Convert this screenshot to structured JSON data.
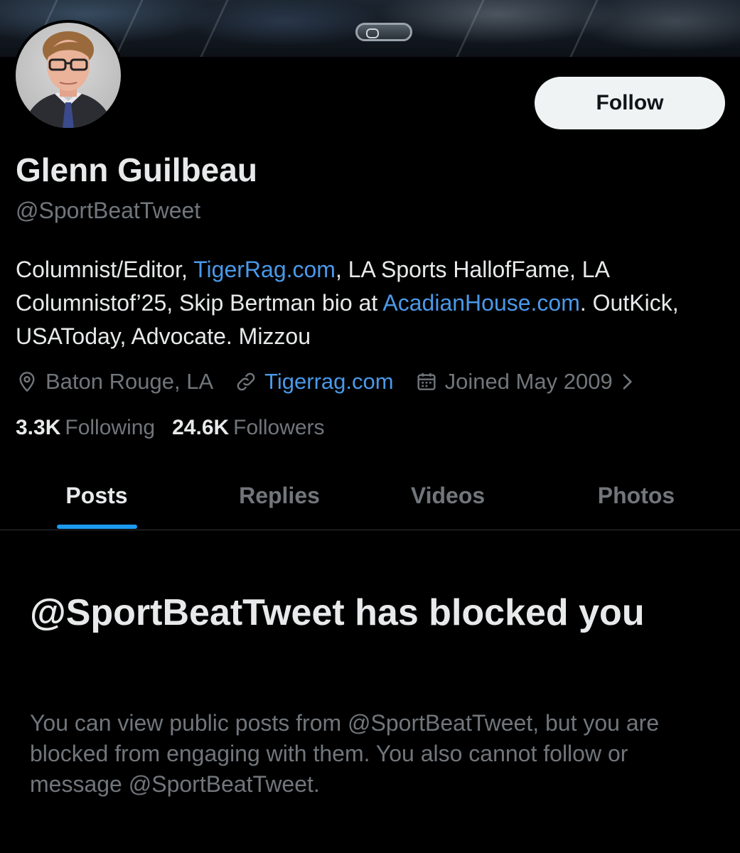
{
  "profile": {
    "name": "Glenn Guilbeau",
    "handle": "@SportBeatTweet",
    "follow_label": "Follow",
    "bio": {
      "part1": "Columnist/Editor, ",
      "link1": "TigerRag.com",
      "part2": ", LA Sports HallofFame, LA Columnistof’25, Skip Bertman bio at ",
      "link2": "AcadianHouse.com",
      "part3": ". OutKick, USAToday, Advocate. Mizzou"
    },
    "meta": {
      "location": "Baton Rouge, LA",
      "website": "Tigerrag.com",
      "joined": "Joined May 2009"
    },
    "stats": {
      "following_count": "3.3K",
      "following_label": "Following",
      "followers_count": "24.6K",
      "followers_label": "Followers"
    }
  },
  "tabs": [
    "Posts",
    "Replies",
    "Videos",
    "Photos"
  ],
  "active_tab": "Posts",
  "blocked": {
    "title": "@SportBeatTweet has blocked you",
    "description": "You can view public posts from @SportBeatTweet, but you are blocked from engaging with them. You also cannot follow or message @SportBeatTweet."
  },
  "colors": {
    "background": "#000000",
    "text_primary": "#e7e9ea",
    "text_secondary": "#71767b",
    "link": "#4a99e9",
    "accent": "#1d9bf0",
    "follow_button_bg": "#eff3f4"
  },
  "icons": [
    "location-pin-icon",
    "link-icon",
    "calendar-icon",
    "chevron-right-icon"
  ]
}
